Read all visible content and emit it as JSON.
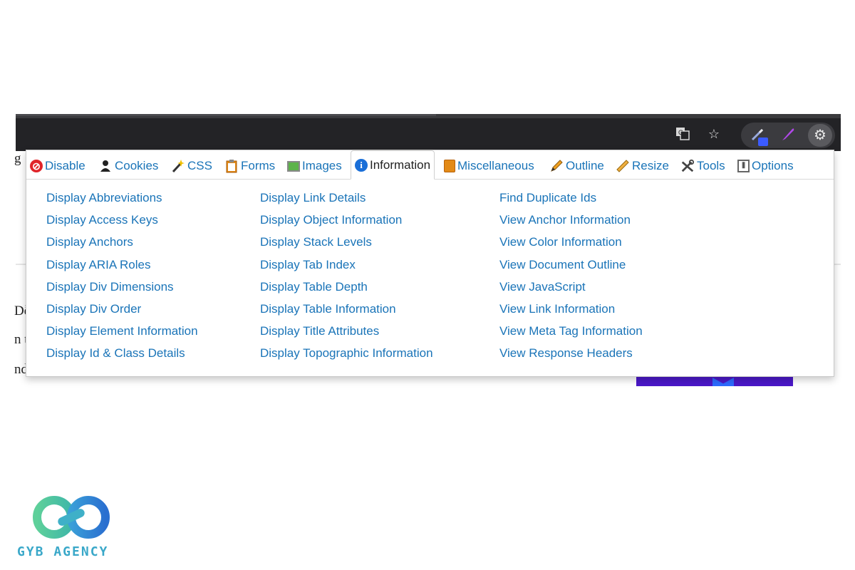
{
  "browser": {
    "toolbar_icons": [
      "translate-icon",
      "star-icon",
      "web-developer-icon",
      "feather-icon",
      "gear-icon"
    ]
  },
  "page_fragments": [
    "g",
    "Dễ",
    "n t",
    "nd"
  ],
  "popup": {
    "tabs": [
      {
        "label": "Disable",
        "icon": "disable-icon"
      },
      {
        "label": "Cookies",
        "icon": "cookies-icon"
      },
      {
        "label": "CSS",
        "icon": "css-wand-icon"
      },
      {
        "label": "Forms",
        "icon": "forms-clipboard-icon"
      },
      {
        "label": "Images",
        "icon": "images-icon"
      },
      {
        "label": "Information",
        "icon": "information-icon",
        "active": true
      },
      {
        "label": "Miscellaneous",
        "icon": "miscellaneous-book-icon"
      },
      {
        "label": "Outline",
        "icon": "outline-pencil-icon"
      },
      {
        "label": "Resize",
        "icon": "resize-ruler-icon"
      },
      {
        "label": "Tools",
        "icon": "tools-icon"
      },
      {
        "label": "Options",
        "icon": "options-icon"
      }
    ],
    "columns": [
      [
        "Display Abbreviations",
        "Display Access Keys",
        "Display Anchors",
        "Display ARIA Roles",
        "Display Div Dimensions",
        "Display Div Order",
        "Display Element Information",
        "Display Id & Class Details"
      ],
      [
        "Display Link Details",
        "Display Object Information",
        "Display Stack Levels",
        "Display Tab Index",
        "Display Table Depth",
        "Display Table Information",
        "Display Title Attributes",
        "Display Topographic Information"
      ],
      [
        "Find Duplicate Ids",
        "View Anchor Information",
        "View Color Information",
        "View Document Outline",
        "View JavaScript",
        "View Link Information",
        "View Meta Tag Information",
        "View Response Headers"
      ]
    ]
  },
  "logo": {
    "text": "GYB AGENCY"
  },
  "colors": {
    "link": "#1a74b8",
    "chrome": "#232326",
    "accent_purple": "#4b18c9",
    "logo_green": "#5ed09a",
    "logo_blue": "#2a8fd8"
  }
}
